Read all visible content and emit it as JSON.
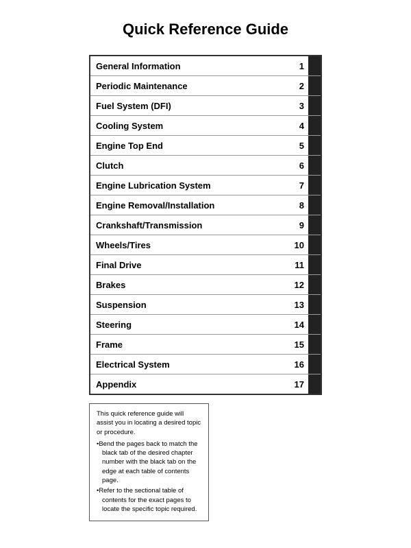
{
  "title": "Quick Reference Guide",
  "entries": [
    {
      "label": "General Information",
      "number": "1"
    },
    {
      "label": "Periodic Maintenance",
      "number": "2"
    },
    {
      "label": "Fuel System (DFI)",
      "number": "3"
    },
    {
      "label": "Cooling System",
      "number": "4"
    },
    {
      "label": "Engine Top End",
      "number": "5"
    },
    {
      "label": "Clutch",
      "number": "6"
    },
    {
      "label": "Engine Lubrication System",
      "number": "7"
    },
    {
      "label": "Engine Removal/Installation",
      "number": "8"
    },
    {
      "label": "Crankshaft/Transmission",
      "number": "9"
    },
    {
      "label": "Wheels/Tires",
      "number": "10"
    },
    {
      "label": "Final Drive",
      "number": "11"
    },
    {
      "label": "Brakes",
      "number": "12"
    },
    {
      "label": "Suspension",
      "number": "13"
    },
    {
      "label": "Steering",
      "number": "14"
    },
    {
      "label": "Frame",
      "number": "15"
    },
    {
      "label": "Electrical System",
      "number": "16"
    },
    {
      "label": "Appendix",
      "number": "17"
    }
  ],
  "note": {
    "first": "This quick reference guide will assist you in locating a desired topic or procedure.",
    "bullet1": "•Bend the pages back to match the black tab of the desired chapter number with the black tab on the edge at each table of contents page.",
    "bullet2": "•Refer to the sectional table of contents for the exact pages to locate the specific topic required."
  }
}
